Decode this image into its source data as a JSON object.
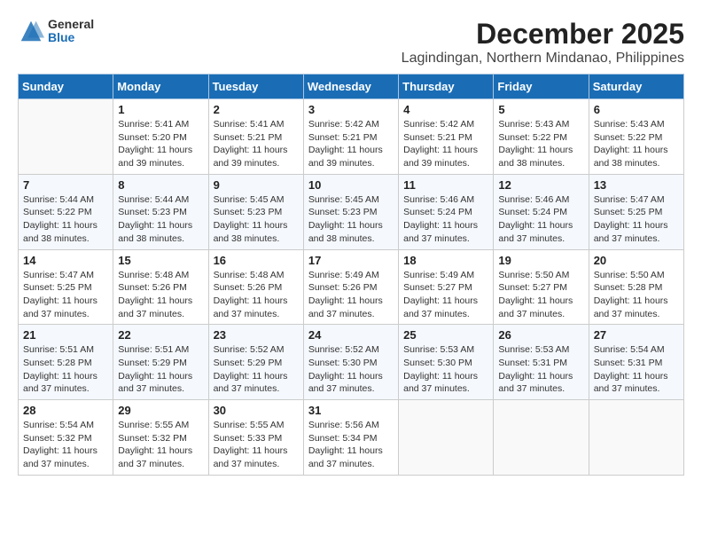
{
  "logo": {
    "general": "General",
    "blue": "Blue"
  },
  "title": "December 2025",
  "location": "Lagindingan, Northern Mindanao, Philippines",
  "days_of_week": [
    "Sunday",
    "Monday",
    "Tuesday",
    "Wednesday",
    "Thursday",
    "Friday",
    "Saturday"
  ],
  "weeks": [
    [
      {
        "day": "",
        "sunrise": "",
        "sunset": "",
        "daylight": ""
      },
      {
        "day": "1",
        "sunrise": "Sunrise: 5:41 AM",
        "sunset": "Sunset: 5:20 PM",
        "daylight": "Daylight: 11 hours and 39 minutes."
      },
      {
        "day": "2",
        "sunrise": "Sunrise: 5:41 AM",
        "sunset": "Sunset: 5:21 PM",
        "daylight": "Daylight: 11 hours and 39 minutes."
      },
      {
        "day": "3",
        "sunrise": "Sunrise: 5:42 AM",
        "sunset": "Sunset: 5:21 PM",
        "daylight": "Daylight: 11 hours and 39 minutes."
      },
      {
        "day": "4",
        "sunrise": "Sunrise: 5:42 AM",
        "sunset": "Sunset: 5:21 PM",
        "daylight": "Daylight: 11 hours and 39 minutes."
      },
      {
        "day": "5",
        "sunrise": "Sunrise: 5:43 AM",
        "sunset": "Sunset: 5:22 PM",
        "daylight": "Daylight: 11 hours and 38 minutes."
      },
      {
        "day": "6",
        "sunrise": "Sunrise: 5:43 AM",
        "sunset": "Sunset: 5:22 PM",
        "daylight": "Daylight: 11 hours and 38 minutes."
      }
    ],
    [
      {
        "day": "7",
        "sunrise": "Sunrise: 5:44 AM",
        "sunset": "Sunset: 5:22 PM",
        "daylight": "Daylight: 11 hours and 38 minutes."
      },
      {
        "day": "8",
        "sunrise": "Sunrise: 5:44 AM",
        "sunset": "Sunset: 5:23 PM",
        "daylight": "Daylight: 11 hours and 38 minutes."
      },
      {
        "day": "9",
        "sunrise": "Sunrise: 5:45 AM",
        "sunset": "Sunset: 5:23 PM",
        "daylight": "Daylight: 11 hours and 38 minutes."
      },
      {
        "day": "10",
        "sunrise": "Sunrise: 5:45 AM",
        "sunset": "Sunset: 5:23 PM",
        "daylight": "Daylight: 11 hours and 38 minutes."
      },
      {
        "day": "11",
        "sunrise": "Sunrise: 5:46 AM",
        "sunset": "Sunset: 5:24 PM",
        "daylight": "Daylight: 11 hours and 37 minutes."
      },
      {
        "day": "12",
        "sunrise": "Sunrise: 5:46 AM",
        "sunset": "Sunset: 5:24 PM",
        "daylight": "Daylight: 11 hours and 37 minutes."
      },
      {
        "day": "13",
        "sunrise": "Sunrise: 5:47 AM",
        "sunset": "Sunset: 5:25 PM",
        "daylight": "Daylight: 11 hours and 37 minutes."
      }
    ],
    [
      {
        "day": "14",
        "sunrise": "Sunrise: 5:47 AM",
        "sunset": "Sunset: 5:25 PM",
        "daylight": "Daylight: 11 hours and 37 minutes."
      },
      {
        "day": "15",
        "sunrise": "Sunrise: 5:48 AM",
        "sunset": "Sunset: 5:26 PM",
        "daylight": "Daylight: 11 hours and 37 minutes."
      },
      {
        "day": "16",
        "sunrise": "Sunrise: 5:48 AM",
        "sunset": "Sunset: 5:26 PM",
        "daylight": "Daylight: 11 hours and 37 minutes."
      },
      {
        "day": "17",
        "sunrise": "Sunrise: 5:49 AM",
        "sunset": "Sunset: 5:26 PM",
        "daylight": "Daylight: 11 hours and 37 minutes."
      },
      {
        "day": "18",
        "sunrise": "Sunrise: 5:49 AM",
        "sunset": "Sunset: 5:27 PM",
        "daylight": "Daylight: 11 hours and 37 minutes."
      },
      {
        "day": "19",
        "sunrise": "Sunrise: 5:50 AM",
        "sunset": "Sunset: 5:27 PM",
        "daylight": "Daylight: 11 hours and 37 minutes."
      },
      {
        "day": "20",
        "sunrise": "Sunrise: 5:50 AM",
        "sunset": "Sunset: 5:28 PM",
        "daylight": "Daylight: 11 hours and 37 minutes."
      }
    ],
    [
      {
        "day": "21",
        "sunrise": "Sunrise: 5:51 AM",
        "sunset": "Sunset: 5:28 PM",
        "daylight": "Daylight: 11 hours and 37 minutes."
      },
      {
        "day": "22",
        "sunrise": "Sunrise: 5:51 AM",
        "sunset": "Sunset: 5:29 PM",
        "daylight": "Daylight: 11 hours and 37 minutes."
      },
      {
        "day": "23",
        "sunrise": "Sunrise: 5:52 AM",
        "sunset": "Sunset: 5:29 PM",
        "daylight": "Daylight: 11 hours and 37 minutes."
      },
      {
        "day": "24",
        "sunrise": "Sunrise: 5:52 AM",
        "sunset": "Sunset: 5:30 PM",
        "daylight": "Daylight: 11 hours and 37 minutes."
      },
      {
        "day": "25",
        "sunrise": "Sunrise: 5:53 AM",
        "sunset": "Sunset: 5:30 PM",
        "daylight": "Daylight: 11 hours and 37 minutes."
      },
      {
        "day": "26",
        "sunrise": "Sunrise: 5:53 AM",
        "sunset": "Sunset: 5:31 PM",
        "daylight": "Daylight: 11 hours and 37 minutes."
      },
      {
        "day": "27",
        "sunrise": "Sunrise: 5:54 AM",
        "sunset": "Sunset: 5:31 PM",
        "daylight": "Daylight: 11 hours and 37 minutes."
      }
    ],
    [
      {
        "day": "28",
        "sunrise": "Sunrise: 5:54 AM",
        "sunset": "Sunset: 5:32 PM",
        "daylight": "Daylight: 11 hours and 37 minutes."
      },
      {
        "day": "29",
        "sunrise": "Sunrise: 5:55 AM",
        "sunset": "Sunset: 5:32 PM",
        "daylight": "Daylight: 11 hours and 37 minutes."
      },
      {
        "day": "30",
        "sunrise": "Sunrise: 5:55 AM",
        "sunset": "Sunset: 5:33 PM",
        "daylight": "Daylight: 11 hours and 37 minutes."
      },
      {
        "day": "31",
        "sunrise": "Sunrise: 5:56 AM",
        "sunset": "Sunset: 5:34 PM",
        "daylight": "Daylight: 11 hours and 37 minutes."
      },
      {
        "day": "",
        "sunrise": "",
        "sunset": "",
        "daylight": ""
      },
      {
        "day": "",
        "sunrise": "",
        "sunset": "",
        "daylight": ""
      },
      {
        "day": "",
        "sunrise": "",
        "sunset": "",
        "daylight": ""
      }
    ]
  ]
}
